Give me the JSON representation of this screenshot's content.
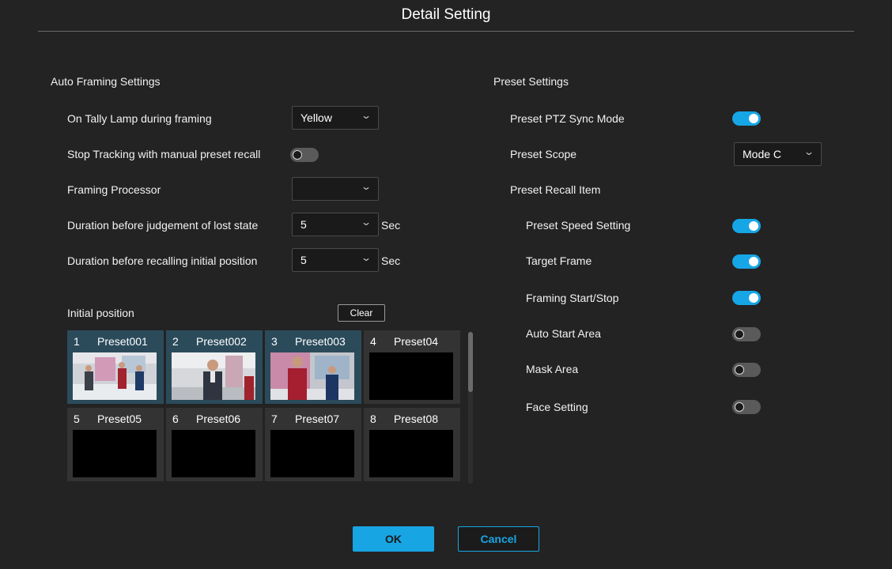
{
  "dialog": {
    "title": "Detail Setting"
  },
  "auto_framing": {
    "heading": "Auto Framing Settings",
    "tally_label": "On Tally Lamp during framing",
    "tally_value": "Yellow",
    "stop_tracking_label": "Stop Tracking with manual preset recall",
    "stop_tracking_on": false,
    "processor_label": "Framing Processor",
    "processor_value": "",
    "lost_label": "Duration before judgement of lost state",
    "lost_value": "5",
    "lost_unit": "Sec",
    "recall_label": "Duration before recalling initial position",
    "recall_value": "5",
    "recall_unit": "Sec"
  },
  "initial_position": {
    "label": "Initial position",
    "clear_label": "Clear",
    "tiles": [
      {
        "num": "1",
        "name": "Preset001",
        "active": true,
        "thumb": "studio-two-presenters"
      },
      {
        "num": "2",
        "name": "Preset002",
        "active": true,
        "thumb": "studio-man-presenter"
      },
      {
        "num": "3",
        "name": "Preset003",
        "active": true,
        "thumb": "studio-woman-presenter"
      },
      {
        "num": "4",
        "name": "Preset04",
        "active": false,
        "thumb": "empty"
      },
      {
        "num": "5",
        "name": "Preset05",
        "active": false,
        "thumb": "empty"
      },
      {
        "num": "6",
        "name": "Preset06",
        "active": false,
        "thumb": "empty"
      },
      {
        "num": "7",
        "name": "Preset07",
        "active": false,
        "thumb": "empty"
      },
      {
        "num": "8",
        "name": "Preset08",
        "active": false,
        "thumb": "empty"
      }
    ]
  },
  "preset": {
    "heading": "Preset Settings",
    "ptz_sync_label": "Preset PTZ Sync Mode",
    "ptz_sync_on": true,
    "scope_label": "Preset Scope",
    "scope_value": "Mode C",
    "recall_item_label": "Preset Recall Item",
    "items": [
      {
        "label": "Preset Speed Setting",
        "on": true
      },
      {
        "label": "Target Frame",
        "on": true
      },
      {
        "label": "Framing Start/Stop",
        "on": true
      },
      {
        "label": "Auto Start Area",
        "on": false
      },
      {
        "label": "Mask Area",
        "on": false
      },
      {
        "label": "Face Setting",
        "on": false
      }
    ]
  },
  "buttons": {
    "ok": "OK",
    "cancel": "Cancel"
  },
  "colors": {
    "accent": "#18a5e4",
    "toggle_off": "#5a5a5a",
    "tile_active": "#2b4b5b"
  }
}
